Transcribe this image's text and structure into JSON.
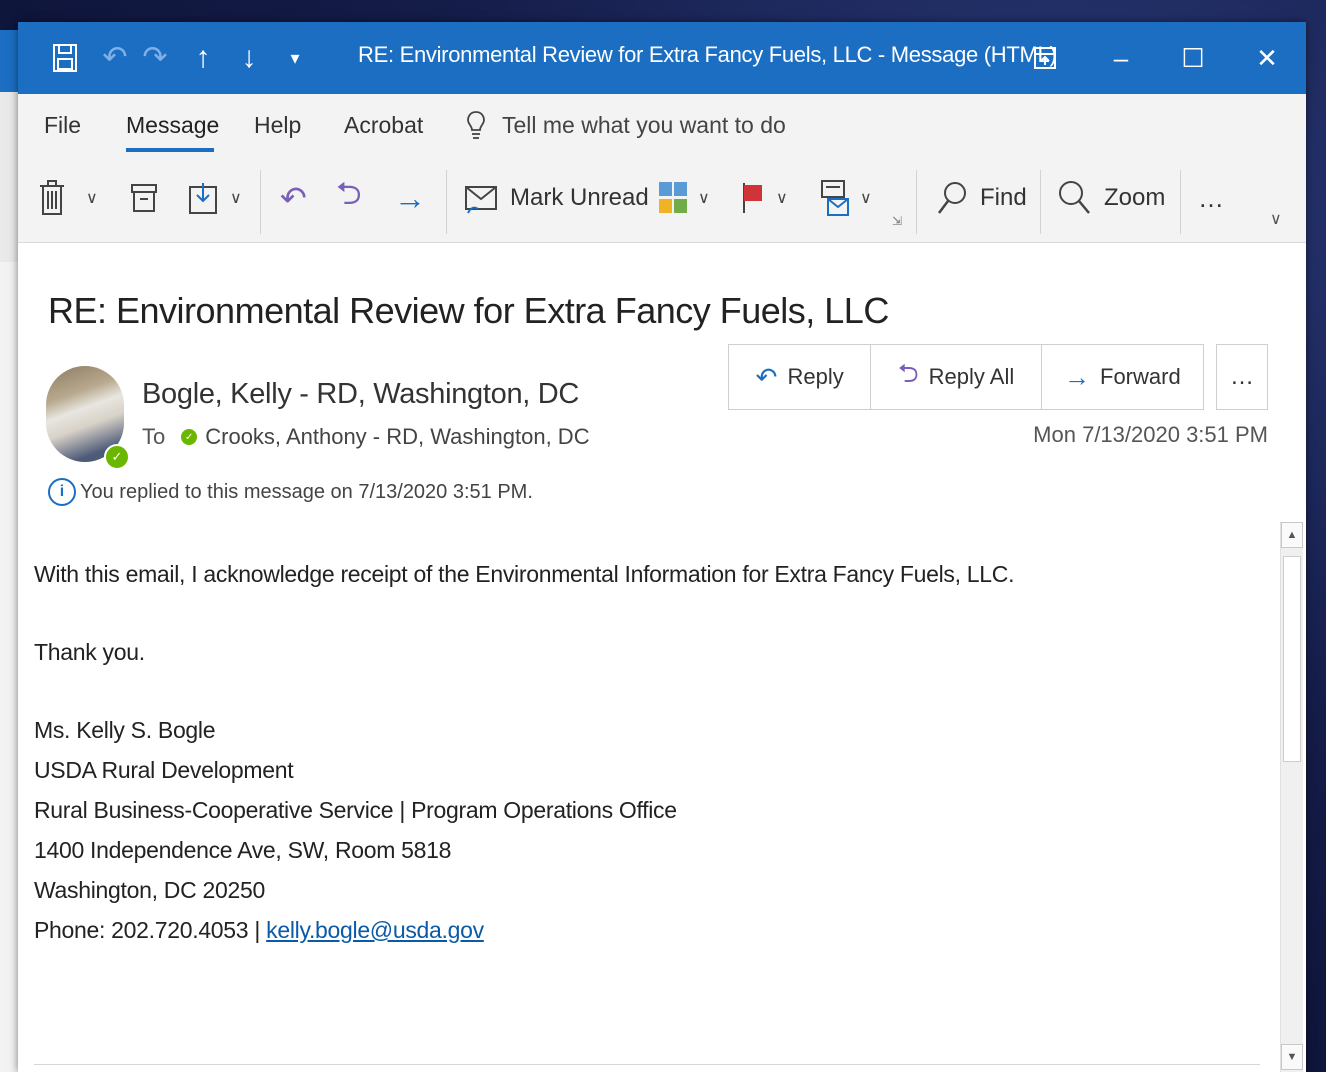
{
  "window": {
    "title": "RE: Environmental Review for Extra Fancy Fuels, LLC  -  Message (HTML)"
  },
  "menu": {
    "items": [
      "File",
      "Message",
      "Help",
      "Acrobat"
    ],
    "active": "Message",
    "tell_me": "Tell me what you want to do"
  },
  "ribbon": {
    "mark_unread": "Mark Unread",
    "find": "Find",
    "zoom": "Zoom",
    "more": "…"
  },
  "message": {
    "subject": "RE: Environmental Review for Extra Fancy Fuels, LLC",
    "sender": "Bogle, Kelly - RD, Washington, DC",
    "to_label": "To",
    "recipient": "Crooks, Anthony - RD, Washington, DC",
    "date": "Mon 7/13/2020 3:51 PM",
    "info": "You replied to this message on 7/13/2020 3:51 PM.",
    "actions": {
      "reply": "Reply",
      "reply_all": "Reply All",
      "forward": "Forward",
      "more": "…"
    }
  },
  "body": {
    "line1": "With this email, I acknowledge receipt of the Environmental Information for Extra Fancy Fuels, LLC.",
    "thanks": "Thank you.",
    "sig_name": "Ms. Kelly S. Bogle",
    "sig_org": "USDA Rural Development",
    "sig_office": "Rural Business-Cooperative Service | Program Operations Office",
    "sig_addr": "1400 Independence Ave, SW, Room 5818",
    "sig_city": "Washington, DC 20250",
    "sig_phone": "Phone: 202.720.4053 | ",
    "sig_email": "kelly.bogle@usda.gov"
  },
  "colors": {
    "accent": "#1b6ec2",
    "presence": "#6bb700",
    "flag": "#d13438",
    "link": "#0b5aa8"
  }
}
